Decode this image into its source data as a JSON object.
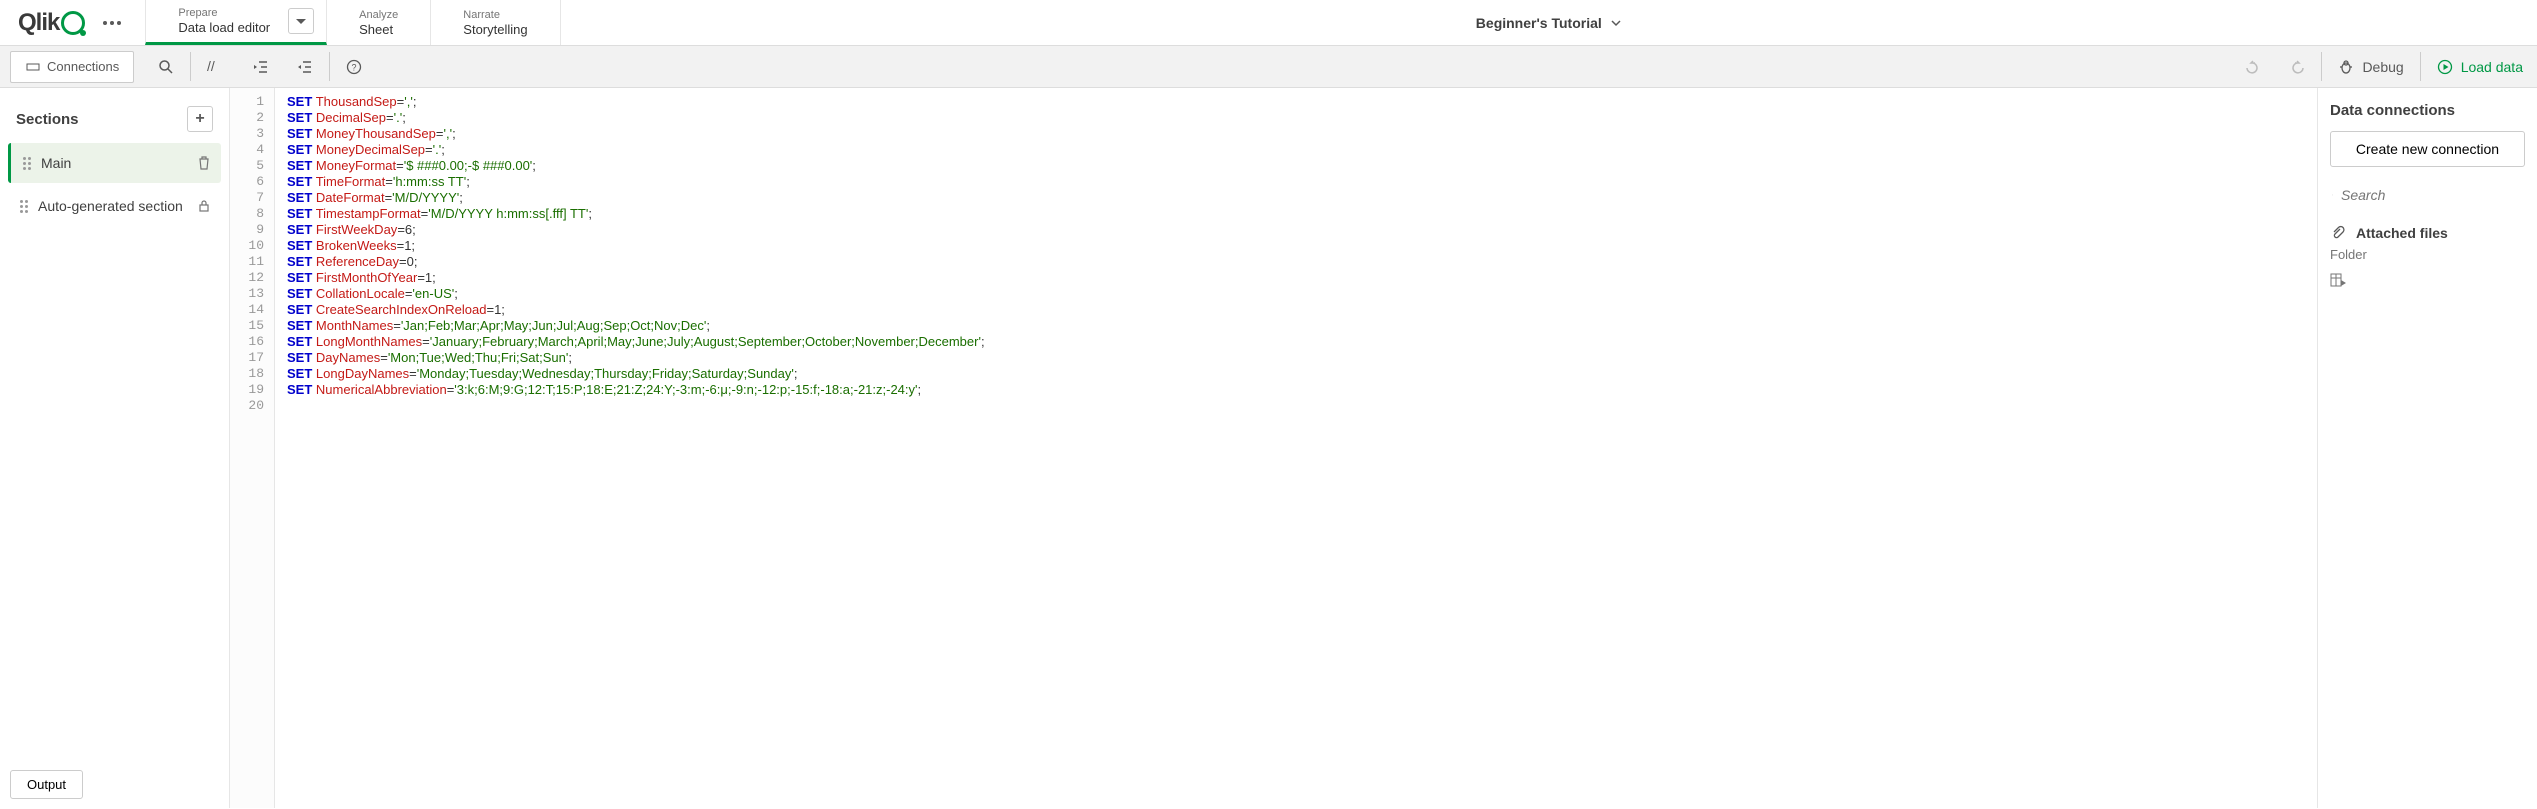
{
  "header": {
    "logo_text": "Qlik",
    "nav": [
      {
        "sub": "Prepare",
        "main": "Data load editor",
        "hasChevron": true
      },
      {
        "sub": "Analyze",
        "main": "Sheet",
        "hasChevron": false
      },
      {
        "sub": "Narrate",
        "main": "Storytelling",
        "hasChevron": false
      }
    ],
    "app_title": "Beginner's Tutorial"
  },
  "toolbar": {
    "connections": "Connections",
    "debug": "Debug",
    "load_data": "Load data"
  },
  "sections": {
    "title": "Sections",
    "items": [
      {
        "label": "Main",
        "action": "delete"
      },
      {
        "label": "Auto-generated section",
        "action": "lock"
      }
    ]
  },
  "editor": {
    "lines": [
      {
        "kw": "SET",
        "var": "ThousandSep",
        "rest": "=',';"
      },
      {
        "kw": "SET",
        "var": "DecimalSep",
        "rest": "='.';"
      },
      {
        "kw": "SET",
        "var": "MoneyThousandSep",
        "rest": "=',';"
      },
      {
        "kw": "SET",
        "var": "MoneyDecimalSep",
        "rest": "='.';"
      },
      {
        "kw": "SET",
        "var": "MoneyFormat",
        "rest": "='$ ###0.00;-$ ###0.00';"
      },
      {
        "kw": "SET",
        "var": "TimeFormat",
        "rest": "='h:mm:ss TT';"
      },
      {
        "kw": "SET",
        "var": "DateFormat",
        "rest": "='M/D/YYYY';"
      },
      {
        "kw": "SET",
        "var": "TimestampFormat",
        "rest": "='M/D/YYYY h:mm:ss[.fff] TT';"
      },
      {
        "kw": "SET",
        "var": "FirstWeekDay",
        "rest": "=6;"
      },
      {
        "kw": "SET",
        "var": "BrokenWeeks",
        "rest": "=1;"
      },
      {
        "kw": "SET",
        "var": "ReferenceDay",
        "rest": "=0;"
      },
      {
        "kw": "SET",
        "var": "FirstMonthOfYear",
        "rest": "=1;"
      },
      {
        "kw": "SET",
        "var": "CollationLocale",
        "rest": "='en-US';"
      },
      {
        "kw": "SET",
        "var": "CreateSearchIndexOnReload",
        "rest": "=1;"
      },
      {
        "kw": "SET",
        "var": "MonthNames",
        "rest": "='Jan;Feb;Mar;Apr;May;Jun;Jul;Aug;Sep;Oct;Nov;Dec';"
      },
      {
        "kw": "SET",
        "var": "LongMonthNames",
        "rest": "='January;February;March;April;May;June;July;August;September;October;November;December';"
      },
      {
        "kw": "SET",
        "var": "DayNames",
        "rest": "='Mon;Tue;Wed;Thu;Fri;Sat;Sun';"
      },
      {
        "kw": "SET",
        "var": "LongDayNames",
        "rest": "='Monday;Tuesday;Wednesday;Thursday;Friday;Saturday;Sunday';"
      },
      {
        "kw": "SET",
        "var": "NumericalAbbreviation",
        "rest": "='3:k;6:M;9:G;12:T;15:P;18:E;21:Z;24:Y;-3:m;-6:μ;-9:n;-12:p;-15:f;-18:a;-21:z;-24:y';"
      }
    ],
    "extra_line_numbers": [
      20
    ]
  },
  "connections": {
    "title": "Data connections",
    "create_button": "Create new connection",
    "search_placeholder": "Search",
    "attached_files": "Attached files",
    "folder": "Folder"
  },
  "footer": {
    "output": "Output"
  }
}
